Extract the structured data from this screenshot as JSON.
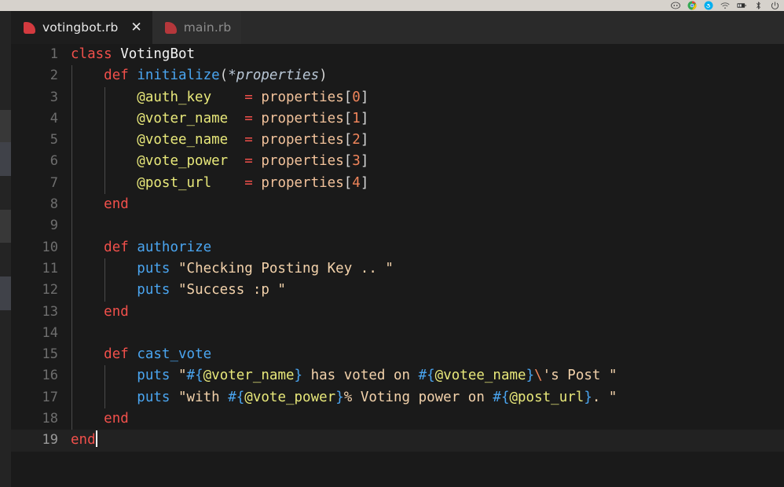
{
  "window": {
    "background_color": "#1a1a1a",
    "tray_background_color": "#d6d2cc"
  },
  "tray": {
    "icons": [
      {
        "name": "discord-icon",
        "glyph": "discord",
        "color": "#5865f2"
      },
      {
        "name": "chrome-icon",
        "glyph": "chrome",
        "color": "#4285f4"
      },
      {
        "name": "skype-icon",
        "glyph": "skype",
        "color": "#00aff0"
      },
      {
        "name": "wifi-icon",
        "glyph": "wifi",
        "color": "#555555"
      },
      {
        "name": "battery-icon",
        "glyph": "battery",
        "color": "#333333"
      },
      {
        "name": "bluetooth-icon",
        "glyph": "bluetooth",
        "color": "#444444"
      },
      {
        "name": "power-icon",
        "glyph": "power",
        "color": "#444444"
      }
    ]
  },
  "tabs": [
    {
      "label": "votingbot.rb",
      "active": true,
      "icon": "ruby-file-icon",
      "close_label": "✕"
    },
    {
      "label": "main.rb",
      "active": false,
      "icon": "ruby-file-icon",
      "close_label": ""
    }
  ],
  "editor": {
    "language": "ruby",
    "active_line": 19,
    "cursor_after_text": "end",
    "theme_colors": {
      "keyword": "#f1504b",
      "class_name": "#f2f2f2",
      "function": "#4aa5f0",
      "parameter": "#b9c7d6",
      "instance_variable": "#e8e87a",
      "operator": "#f1504b",
      "variable": "#f2c29b",
      "number": "#f0855b",
      "string": "#f3d2ab",
      "interpolation": "#4aa5f0",
      "escape": "#f0855b",
      "line_number": "#6e6e6e",
      "active_line_background": "#222222",
      "editor_background": "#1a1a1a"
    },
    "lines": [
      {
        "n": "1",
        "text": "class VotingBot"
      },
      {
        "n": "2",
        "text": "    def initialize(*properties)"
      },
      {
        "n": "3",
        "text": "        @auth_key    = properties[0]"
      },
      {
        "n": "4",
        "text": "        @voter_name  = properties[1]"
      },
      {
        "n": "5",
        "text": "        @votee_name  = properties[2]"
      },
      {
        "n": "6",
        "text": "        @vote_power  = properties[3]"
      },
      {
        "n": "7",
        "text": "        @post_url    = properties[4]"
      },
      {
        "n": "8",
        "text": "    end"
      },
      {
        "n": "9",
        "text": ""
      },
      {
        "n": "10",
        "text": "    def authorize"
      },
      {
        "n": "11",
        "text": "        puts \"Checking Posting Key .. \""
      },
      {
        "n": "12",
        "text": "        puts \"Success :p \""
      },
      {
        "n": "13",
        "text": "    end"
      },
      {
        "n": "14",
        "text": ""
      },
      {
        "n": "15",
        "text": "    def cast_vote"
      },
      {
        "n": "16",
        "text": "        puts \"#{@voter_name} has voted on #{@votee_name}\\'s Post \""
      },
      {
        "n": "17",
        "text": "        puts \"with #{@vote_power}% Voting power on #{@post_url}. \""
      },
      {
        "n": "18",
        "text": "    end"
      },
      {
        "n": "19",
        "text": "end"
      }
    ]
  }
}
